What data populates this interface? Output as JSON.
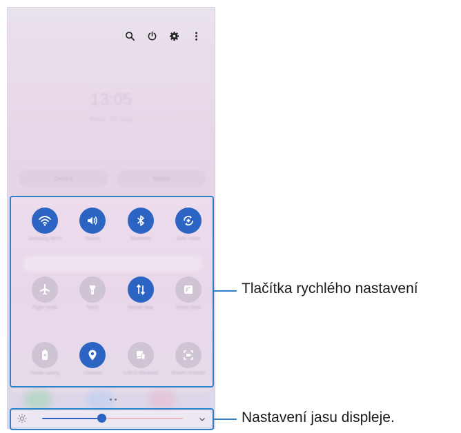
{
  "status_icons": [
    {
      "name": "search-icon"
    },
    {
      "name": "power-icon"
    },
    {
      "name": "gear-icon"
    },
    {
      "name": "more-icon"
    }
  ],
  "clock": {
    "time": "13:05",
    "date": "Wed, 26 July"
  },
  "pills": {
    "left": "Device",
    "right": "Media"
  },
  "tiles": [
    {
      "name": "tile-wifi",
      "icon": "wifi-icon",
      "state": "on",
      "label": "Samsung Wi-Fi"
    },
    {
      "name": "tile-sound",
      "icon": "sound-icon",
      "state": "on",
      "label": "Sound"
    },
    {
      "name": "tile-bluetooth",
      "icon": "bluetooth-icon",
      "state": "on",
      "label": "Bluetooth"
    },
    {
      "name": "tile-auto-rotate",
      "icon": "rotate-icon",
      "state": "on",
      "label": "Auto rotate"
    },
    {
      "name": "tile-airplane",
      "icon": "airplane-icon",
      "state": "off",
      "label": "Flight mode"
    },
    {
      "name": "tile-torch",
      "icon": "flashlight-icon",
      "state": "off",
      "label": "Torch"
    },
    {
      "name": "tile-mobile-data",
      "icon": "data-icon",
      "state": "on",
      "label": "Mobile data"
    },
    {
      "name": "tile-cast",
      "icon": "cast-icon",
      "state": "off",
      "label": "Smart View"
    },
    {
      "name": "tile-power-saving",
      "icon": "battery-icon",
      "state": "off",
      "label": "Power saving"
    },
    {
      "name": "tile-location",
      "icon": "location-icon",
      "state": "on",
      "label": "Location"
    },
    {
      "name": "tile-link",
      "icon": "link-icon",
      "state": "off",
      "label": "Link to Windows"
    },
    {
      "name": "tile-screen-recorder",
      "icon": "screen-record-icon",
      "state": "off",
      "label": "Screen recorder"
    }
  ],
  "brightness": {
    "level": 0.42
  },
  "colors": {
    "accent": "#2c64c4",
    "callout_line": "#2f7fc9"
  },
  "callouts": {
    "quick_settings": "Tlačítka rychlého nastavení",
    "brightness": "Nastavení jasu displeje."
  }
}
